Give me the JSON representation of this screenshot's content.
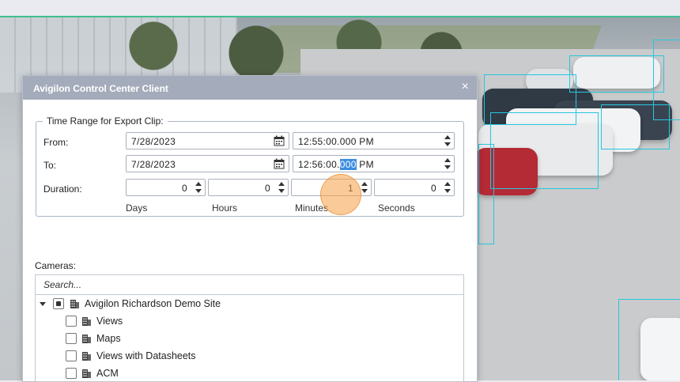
{
  "dialog": {
    "title": "Avigilon Control Center Client",
    "close_glyph": "×"
  },
  "time_range": {
    "legend": "Time Range for Export Clip:",
    "from_label": "From:",
    "to_label": "To:",
    "duration_label": "Duration:",
    "from_date": "7/28/2023",
    "from_time": "12:55:00.000 PM",
    "to_date": "7/28/2023",
    "to_time_before": "12:56:00.",
    "to_time_selected": "000",
    "to_time_after": " PM",
    "duration": {
      "days": "0",
      "hours": "0",
      "minutes": "1",
      "seconds": "0"
    },
    "units": {
      "days": "Days",
      "hours": "Hours",
      "minutes": "Minutes",
      "seconds": "Seconds"
    }
  },
  "cameras": {
    "label": "Cameras:",
    "search_placeholder": "Search...",
    "tree": [
      {
        "label": "Avigilon Richardson Demo Site",
        "state": "partial",
        "expanded": true,
        "level": 0
      },
      {
        "label": "Views",
        "state": "unchecked",
        "level": 1
      },
      {
        "label": "Maps",
        "state": "unchecked",
        "level": 1
      },
      {
        "label": "Views with Datasheets",
        "state": "unchecked",
        "level": 1
      },
      {
        "label": "ACM",
        "state": "unchecked",
        "level": 1
      }
    ]
  },
  "icons": {
    "calendar": "calendar-icon",
    "spinner": "spinner-arrows-icon",
    "building": "building-icon",
    "expand": "caret-down-icon",
    "close": "close-icon"
  },
  "colors": {
    "titlebar": "#a4acbb",
    "selection": "#3c8ce0",
    "detection_box": "#28c6de",
    "cursor_highlight": "#f5a046",
    "top_accent": "#3fbf92"
  }
}
